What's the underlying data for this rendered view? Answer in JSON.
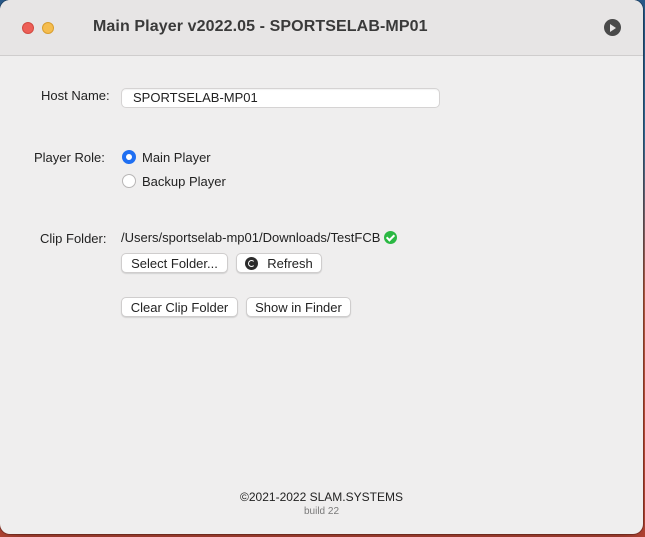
{
  "window": {
    "title": "Main Player v2022.05 - SPORTSELAB-MP01"
  },
  "form": {
    "host_name_label": "Host Name:",
    "host_name_value": "SPORTSELAB-MP01",
    "player_role_label": "Player Role:",
    "roles": [
      {
        "label": "Main Player",
        "selected": true
      },
      {
        "label": "Backup Player",
        "selected": false
      }
    ],
    "clip_folder_label": "Clip Folder:",
    "clip_folder_path": "/Users/sportselab-mp01/Downloads/TestFCB"
  },
  "buttons": {
    "select_folder": "Select Folder...",
    "refresh": "Refresh",
    "clear_clip_folder": "Clear Clip Folder",
    "show_in_finder": "Show in Finder"
  },
  "footer": {
    "copyright": "©2021-2022 SLAM.SYSTEMS",
    "build": "build 22"
  },
  "colors": {
    "accent": "#1f6ff2",
    "status_ok": "#2bb843",
    "close": "#ed5f57",
    "minimize": "#f5bd4f"
  },
  "icons": {
    "play": "play-icon",
    "status": "checkmark-circle-icon",
    "refresh": "refresh-icon"
  }
}
